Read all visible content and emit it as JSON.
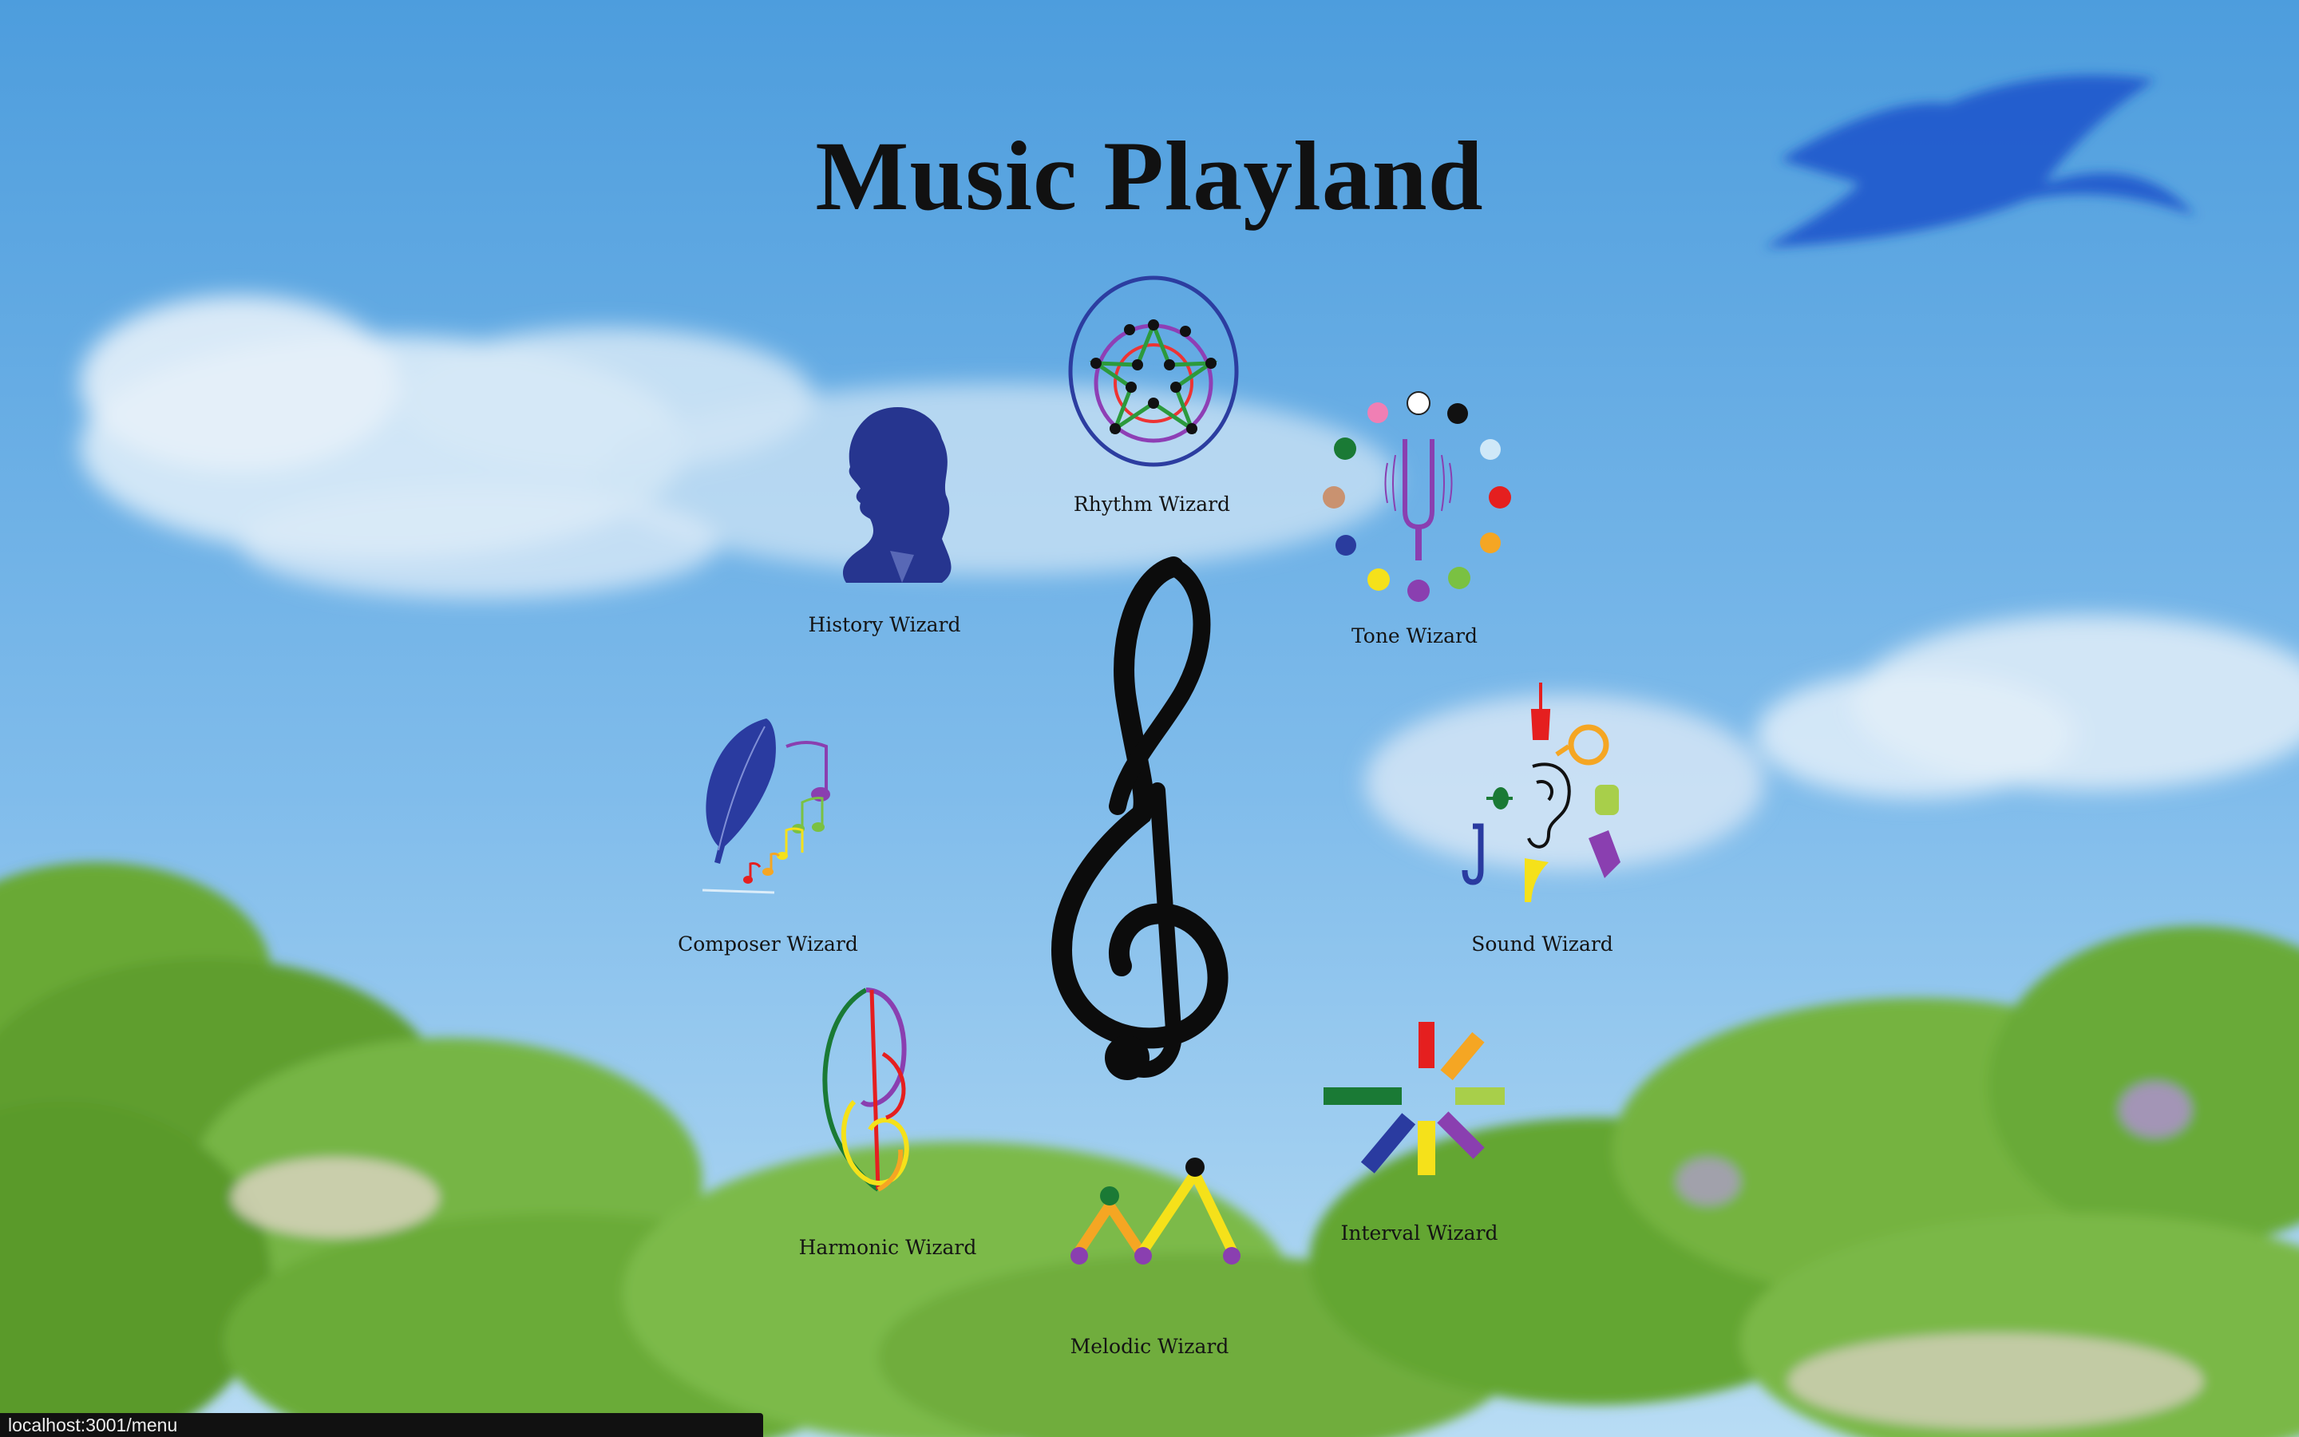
{
  "page": {
    "title": "Music Playland"
  },
  "wizards": {
    "rhythm": "Rhythm Wizard",
    "history": "History Wizard",
    "tone": "Tone Wizard",
    "composer": "Composer Wizard",
    "sound": "Sound Wizard",
    "harmonic": "Harmonic Wizard",
    "melodic": "Melodic Wizard",
    "interval": "Interval Wizard"
  },
  "status_bar": {
    "url": "localhost:3001/menu"
  },
  "icons": {
    "center": "treble-clef-icon",
    "rhythm": "rhythm-star-circle-icon",
    "history": "composer-silhouette-icon",
    "tone": "tuning-fork-circle-icon",
    "composer": "quill-notes-icon",
    "sound": "ear-instruments-icon",
    "harmonic": "rainbow-clef-icon",
    "melodic": "melody-zigzag-icon",
    "interval": "interval-burst-icon"
  },
  "colors": {
    "sky_top": "#4f9fdf",
    "sky_bottom": "#a9d4f2",
    "foliage": "#6aae3c",
    "icon_navy": "#26358f"
  }
}
